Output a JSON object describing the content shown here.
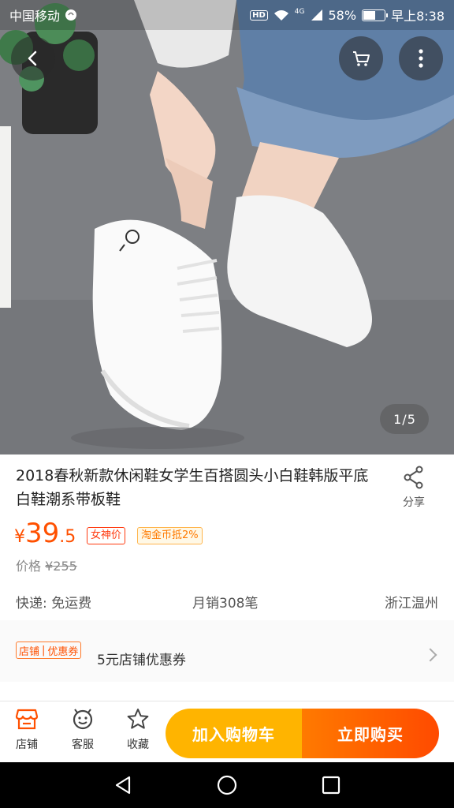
{
  "status_bar": {
    "carrier": "中国移动",
    "hd": "HD",
    "network": "4G",
    "battery_text": "58%",
    "battery_level": 0.58,
    "time": "早上8:38"
  },
  "gallery": {
    "current": "1",
    "separator": "/",
    "total": "5"
  },
  "product": {
    "title": "2018春秋新款休闲鞋女学生百搭圆头小白鞋韩版平底白鞋潮系带板鞋",
    "share_label": "分享",
    "price_symbol": "¥",
    "price_integer": "39",
    "price_decimal": ".5",
    "tag_goddess": "女神价",
    "tag_coin": "淘金币抵2%",
    "original_price_label": "价格",
    "original_price": "¥255",
    "shipping": "快递: 免运费",
    "monthly_sales": "月销308笔",
    "location": "浙江温州"
  },
  "coupon": {
    "badge_left": "店铺",
    "badge_right": "优惠券",
    "text": "5元店铺优惠券"
  },
  "bottom_bar": {
    "shop_label": "店铺",
    "service_label": "客服",
    "favorite_label": "收藏",
    "add_to_cart": "加入购物车",
    "buy_now": "立即购买"
  },
  "colors": {
    "accent": "#ff5000",
    "cart_button": "#ffb400",
    "buy_button": "#ff4a00"
  }
}
